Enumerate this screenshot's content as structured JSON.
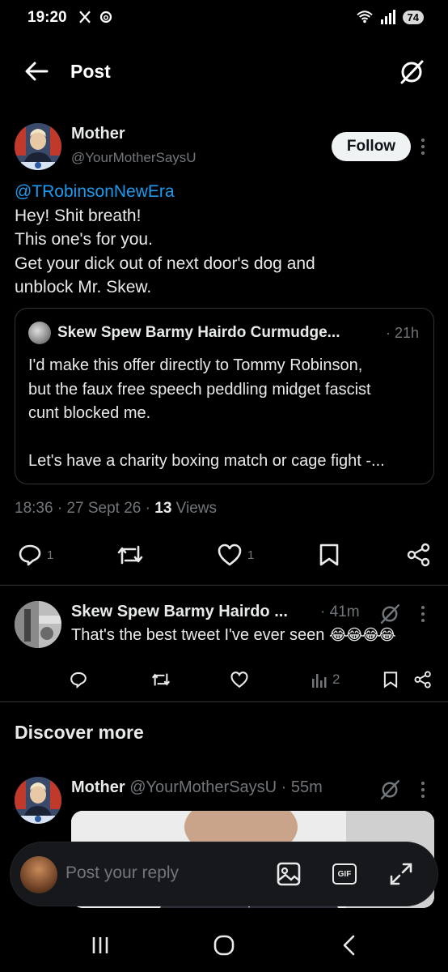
{
  "status": {
    "time": "19:20",
    "left_icons": [
      "x-logo-icon",
      "threads-icon"
    ],
    "right_icons": [
      "wifi-icon",
      "signal-icon"
    ],
    "battery": "74"
  },
  "topbar": {
    "title": "Post",
    "back_icon": "arrow-left-icon",
    "grok_icon": "grok-icon"
  },
  "post": {
    "name": "Mother",
    "handle": "@YourMotherSaysU",
    "follow_label": "Follow",
    "mention": "@TRobinsonNewEra",
    "lines": [
      "Hey! Shit breath!",
      "This one's for you.",
      "Get your dick out of next door's dog and",
      "unblock Mr. Skew."
    ],
    "quote": {
      "name": "Skew Spew Barmy Hairdo Curmudge...",
      "time": "· 21h",
      "lines": [
        "I'd make this offer directly to Tommy Robinson,",
        "but the faux free speech peddling midget fascist",
        "cunt blocked me.",
        "",
        "Let's have a charity boxing match or cage fight -..."
      ]
    },
    "meta": {
      "time": "18:36",
      "date": "27 Sept 26",
      "views_count": "13",
      "views_label": "Views"
    },
    "actions": {
      "reply_count": "1",
      "repost_count": "",
      "like_count": "1"
    }
  },
  "reply": {
    "name": "Skew Spew Barmy Hairdo ...",
    "time": "· 41m",
    "text": "That's the best tweet I've ever seen",
    "emoji": "😂😂😂😂",
    "view_count": "2"
  },
  "discover": {
    "heading": "Discover more",
    "item": {
      "name": "Mother",
      "handle": "@YourMotherSaysU",
      "time": "· 55m"
    }
  },
  "reply_bar": {
    "placeholder": "Post your reply",
    "gif_label": "GIF"
  },
  "colors": {
    "background": "#000000",
    "text": "#e7e9ea",
    "secondary": "#71767b",
    "link": "#1d9bf0",
    "border": "#2f3336"
  }
}
